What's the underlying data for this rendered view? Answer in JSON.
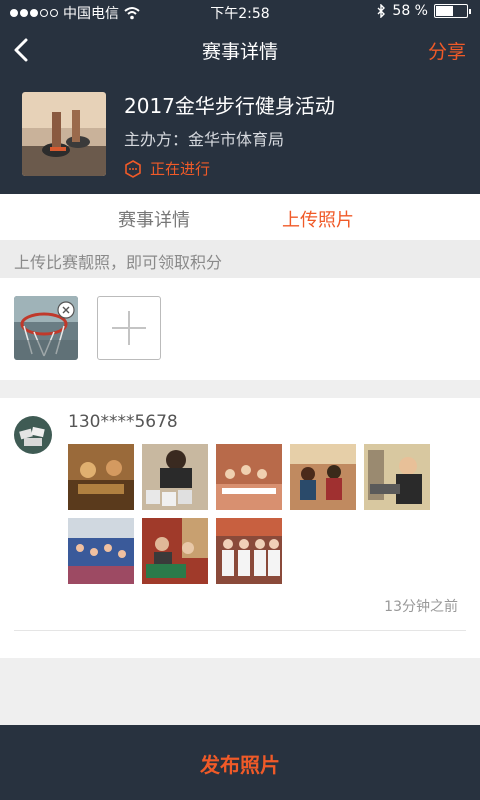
{
  "status_bar": {
    "carrier": "中国电信",
    "time": "下午2:58",
    "battery_percent_text": "58 %",
    "battery_level": 0.58
  },
  "nav": {
    "title": "赛事详情",
    "share_label": "分享",
    "back_icon": "chevron-left-icon"
  },
  "event": {
    "title": "2017金华步行健身活动",
    "organizer": "主办方：金华市体育局",
    "status": "正在进行"
  },
  "tabs": [
    {
      "label": "赛事详情",
      "active": false
    },
    {
      "label": "上传照片",
      "active": true
    }
  ],
  "upload": {
    "hint": "上传比赛靓照，即可领取积分",
    "add_icon": "plus-icon",
    "remove_icon": "close-circle-icon"
  },
  "post": {
    "user": "130****5678",
    "time": "13分钟之前",
    "photo_count": 8
  },
  "footer": {
    "publish_label": "发布照片"
  },
  "colors": {
    "accent": "#f05a28",
    "dark": "#28323f",
    "background": "#efefef"
  }
}
